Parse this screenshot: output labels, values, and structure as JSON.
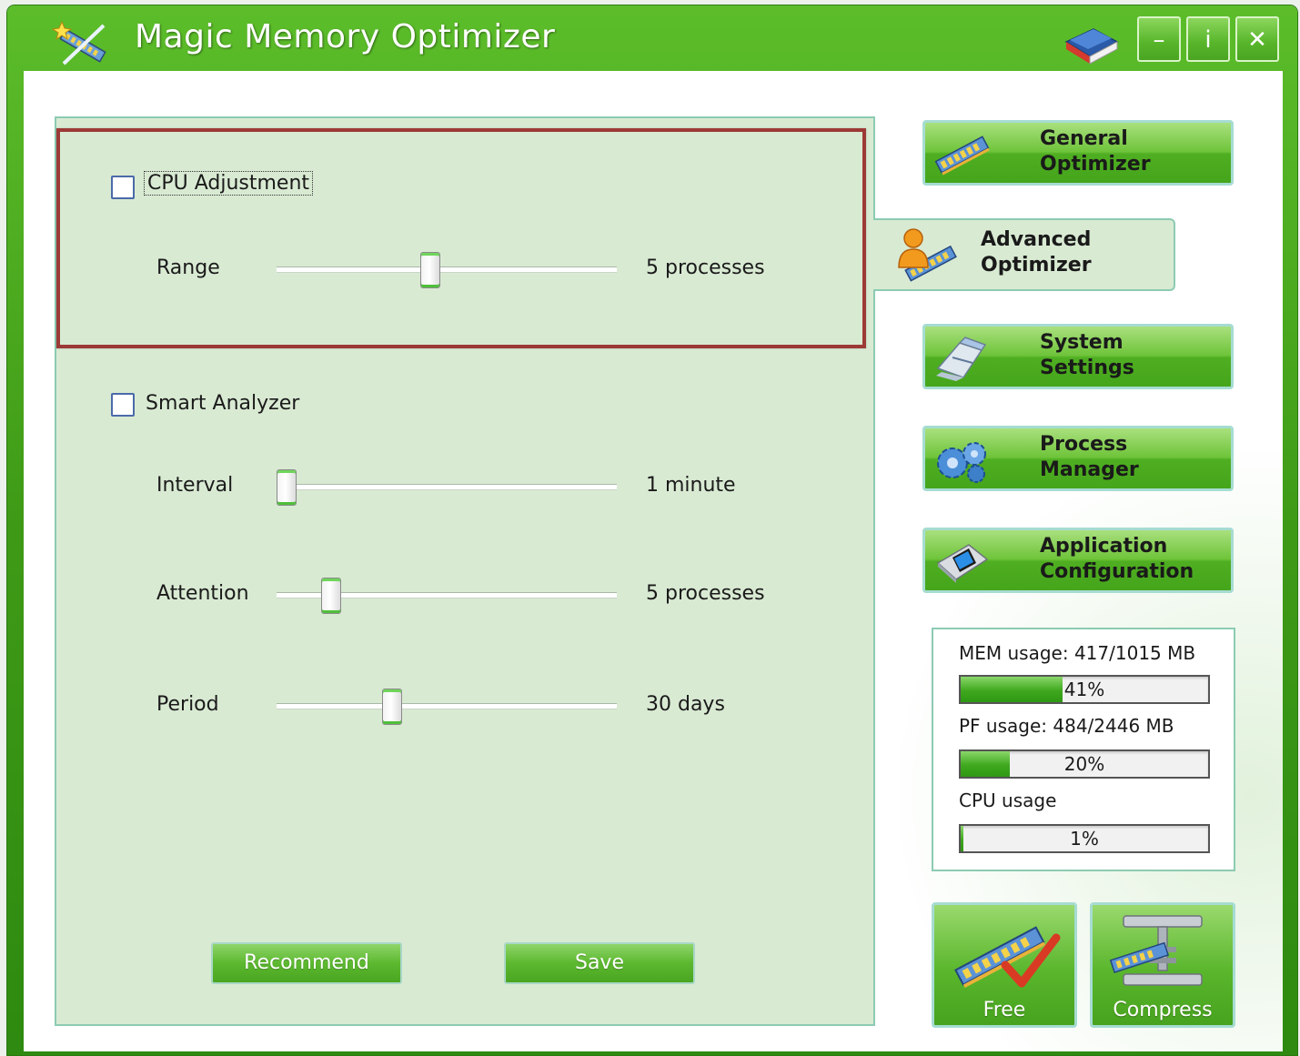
{
  "window": {
    "title": "Magic Memory Optimizer",
    "controls": {
      "minimize": "–",
      "help": "i",
      "close": "✕"
    }
  },
  "cpu_adjustment": {
    "checkbox_label": "CPU Adjustment",
    "checked": false,
    "range": {
      "label": "Range",
      "value_text": "5 processes",
      "level": 0.45
    }
  },
  "smart_analyzer": {
    "checkbox_label": "Smart Analyzer",
    "checked": false,
    "interval": {
      "label": "Interval",
      "value_text": "1 minute",
      "level": 0.0
    },
    "attention": {
      "label": "Attention",
      "value_text": "5 processes",
      "level": 0.14
    },
    "period": {
      "label": "Period",
      "value_text": "30 days",
      "level": 0.33
    }
  },
  "buttons": {
    "recommend": "Recommend",
    "save": "Save"
  },
  "nav": {
    "general": {
      "line1": "General",
      "line2": "Optimizer"
    },
    "advanced": {
      "line1": "Advanced",
      "line2": "Optimizer"
    },
    "system": {
      "line1": "System",
      "line2": "Settings"
    },
    "process": {
      "line1": "Process",
      "line2": "Manager"
    },
    "application": {
      "line1": "Application",
      "line2": "Configuration"
    }
  },
  "stats": {
    "mem": {
      "label": "MEM usage: 417/1015 MB",
      "percent_text": "41%",
      "fraction": 0.41
    },
    "pf": {
      "label": "PF usage: 484/2446 MB",
      "percent_text": "20%",
      "fraction": 0.2
    },
    "cpu": {
      "label": "CPU usage",
      "percent_text": "1%",
      "fraction": 0.01
    }
  },
  "actions": {
    "free": "Free",
    "compress": "Compress"
  },
  "icons": {
    "app": "wand-ram-icon",
    "help_book": "book-icon",
    "general": "ram-stick-icon",
    "advanced": "user-ram-icon",
    "system": "settings-tools-icon",
    "process": "gears-icon",
    "application": "phone-config-icon",
    "free": "ram-checkmark-icon",
    "compress": "ram-clamp-icon"
  },
  "colors": {
    "title_green": "#3e9a16",
    "panel_bg": "#d9ead3",
    "highlight_border": "#9c3a36",
    "progress_green": "#3fa81e"
  }
}
